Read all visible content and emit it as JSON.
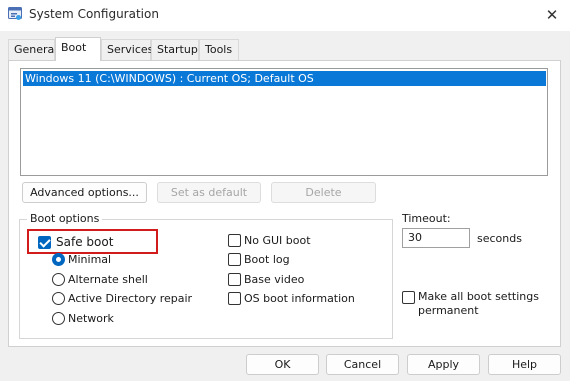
{
  "window": {
    "title": "System Configuration",
    "close_glyph": "✕",
    "app_icon": "msconfig-icon"
  },
  "tabs": [
    {
      "label": "General",
      "active": false
    },
    {
      "label": "Boot",
      "active": true
    },
    {
      "label": "Services",
      "active": false
    },
    {
      "label": "Startup",
      "active": false
    },
    {
      "label": "Tools",
      "active": false
    }
  ],
  "os_list": {
    "items": [
      "Windows 11 (C:\\WINDOWS) : Current OS; Default OS"
    ],
    "selected_index": 0
  },
  "boot_buttons": {
    "advanced": "Advanced options...",
    "set_default": "Set as default",
    "delete": "Delete"
  },
  "boot_options": {
    "legend": "Boot options",
    "safe_boot": {
      "label": "Safe boot",
      "checked": true
    },
    "safe_boot_modes": [
      {
        "label": "Minimal",
        "checked": true
      },
      {
        "label": "Alternate shell",
        "checked": false
      },
      {
        "label": "Active Directory repair",
        "checked": false
      },
      {
        "label": "Network",
        "checked": false
      }
    ],
    "no_gui_boot": {
      "label": "No GUI boot",
      "checked": false
    },
    "boot_log": {
      "label": "Boot log",
      "checked": false
    },
    "base_video": {
      "label": "Base video",
      "checked": false
    },
    "os_boot_info": {
      "label": "OS boot information",
      "checked": false
    }
  },
  "timeout": {
    "label": "Timeout:",
    "value": "30",
    "unit": "seconds"
  },
  "make_permanent": {
    "label_line1": "Make all boot settings",
    "label_line2": "permanent",
    "checked": false
  },
  "dialog_buttons": {
    "ok": "OK",
    "cancel": "Cancel",
    "apply": "Apply",
    "help": "Help"
  },
  "colors": {
    "selection": "#0a78d7",
    "check_accent": "#0067c0",
    "highlight_box": "#d21c1c"
  }
}
